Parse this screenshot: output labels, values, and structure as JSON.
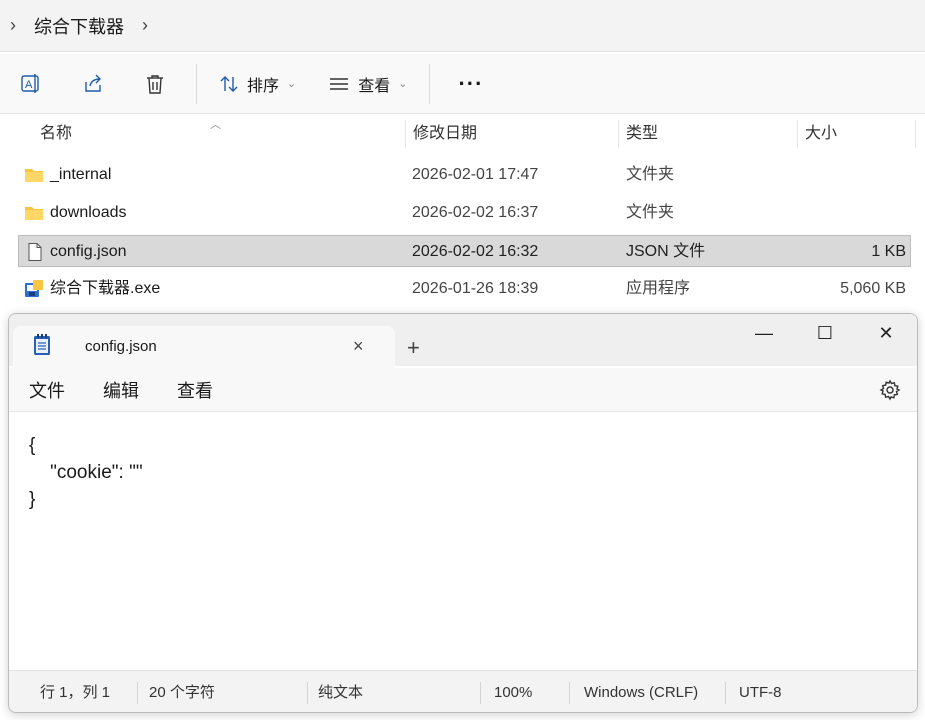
{
  "explorer": {
    "breadcrumb": {
      "current": "综合下载器"
    },
    "toolbar": {
      "sort_label": "排序",
      "view_label": "查看",
      "more_label": "···"
    },
    "columns": {
      "name": "名称",
      "date": "修改日期",
      "type": "类型",
      "size": "大小"
    },
    "files": [
      {
        "name": "_internal",
        "date": "2026-02-01 17:47",
        "type": "文件夹",
        "size": "",
        "icon": "folder-icon"
      },
      {
        "name": "downloads",
        "date": "2026-02-02 16:37",
        "type": "文件夹",
        "size": "",
        "icon": "folder-icon"
      },
      {
        "name": "config.json",
        "date": "2026-02-02 16:32",
        "type": "JSON 文件",
        "size": "1 KB",
        "icon": "file-icon",
        "selected": true
      },
      {
        "name": "综合下载器.exe",
        "date": "2026-01-26 18:39",
        "type": "应用程序",
        "size": "5,060 KB",
        "icon": "app-icon"
      }
    ]
  },
  "notepad": {
    "tab_title": "config.json",
    "tab_close": "×",
    "new_tab": "+",
    "window": {
      "minimize": "—",
      "maximize": "☐",
      "close": "✕"
    },
    "menu": {
      "file": "文件",
      "edit": "编辑",
      "view": "查看"
    },
    "content": "{\n    \"cookie\": \"\"\n}",
    "status": {
      "position": "行 1，列 1",
      "chars": "20 个字符",
      "format": "纯文本",
      "zoom": "100%",
      "line_ending": "Windows (CRLF)",
      "encoding": "UTF-8"
    }
  },
  "colors": {
    "folder": "#f6c544",
    "selection": "#d9d9d9"
  }
}
